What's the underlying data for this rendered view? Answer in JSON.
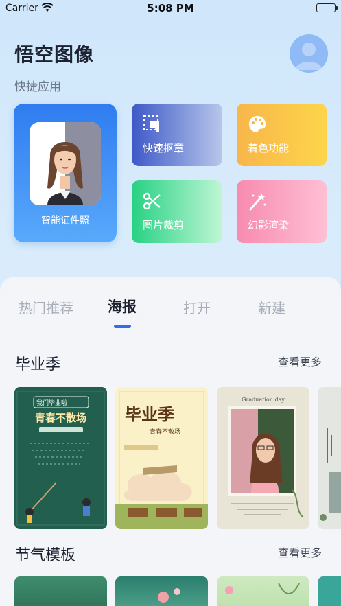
{
  "status_bar": {
    "carrier": "Carrier",
    "time": "5:08 PM"
  },
  "header": {
    "app_title": "悟空图像",
    "quick_apps_label": "快捷应用"
  },
  "quick_apps": [
    {
      "label": "智能证件照",
      "icon": "id-photo-icon"
    },
    {
      "label": "快速抠章",
      "icon": "cutout-icon"
    },
    {
      "label": "着色功能",
      "icon": "palette-icon"
    },
    {
      "label": "图片裁剪",
      "icon": "scissors-icon"
    },
    {
      "label": "幻影渲染",
      "icon": "magic-wand-icon"
    }
  ],
  "tabs": [
    {
      "label": "热门推荐",
      "active": false
    },
    {
      "label": "海报",
      "active": true
    },
    {
      "label": "打开",
      "active": false
    },
    {
      "label": "新建",
      "active": false
    }
  ],
  "sections": [
    {
      "title": "毕业季",
      "see_more": "查看更多",
      "templates": [
        {
          "theme": "chalkboard",
          "text": "青春不散场",
          "caption": "我们毕业啦"
        },
        {
          "theme": "retro",
          "text": "毕业季",
          "caption": "青春不散场"
        },
        {
          "theme": "photo",
          "text": "Graduation day"
        },
        {
          "theme": "light"
        }
      ]
    },
    {
      "title": "节气模板",
      "see_more": "查看更多"
    }
  ],
  "colors": {
    "accent": "#2f6fe8",
    "id_card": "#3a86f2",
    "cutout": "#3e59c8",
    "coloring": "#fbc34a",
    "crop": "#27d184",
    "render": "#f78bb0"
  }
}
